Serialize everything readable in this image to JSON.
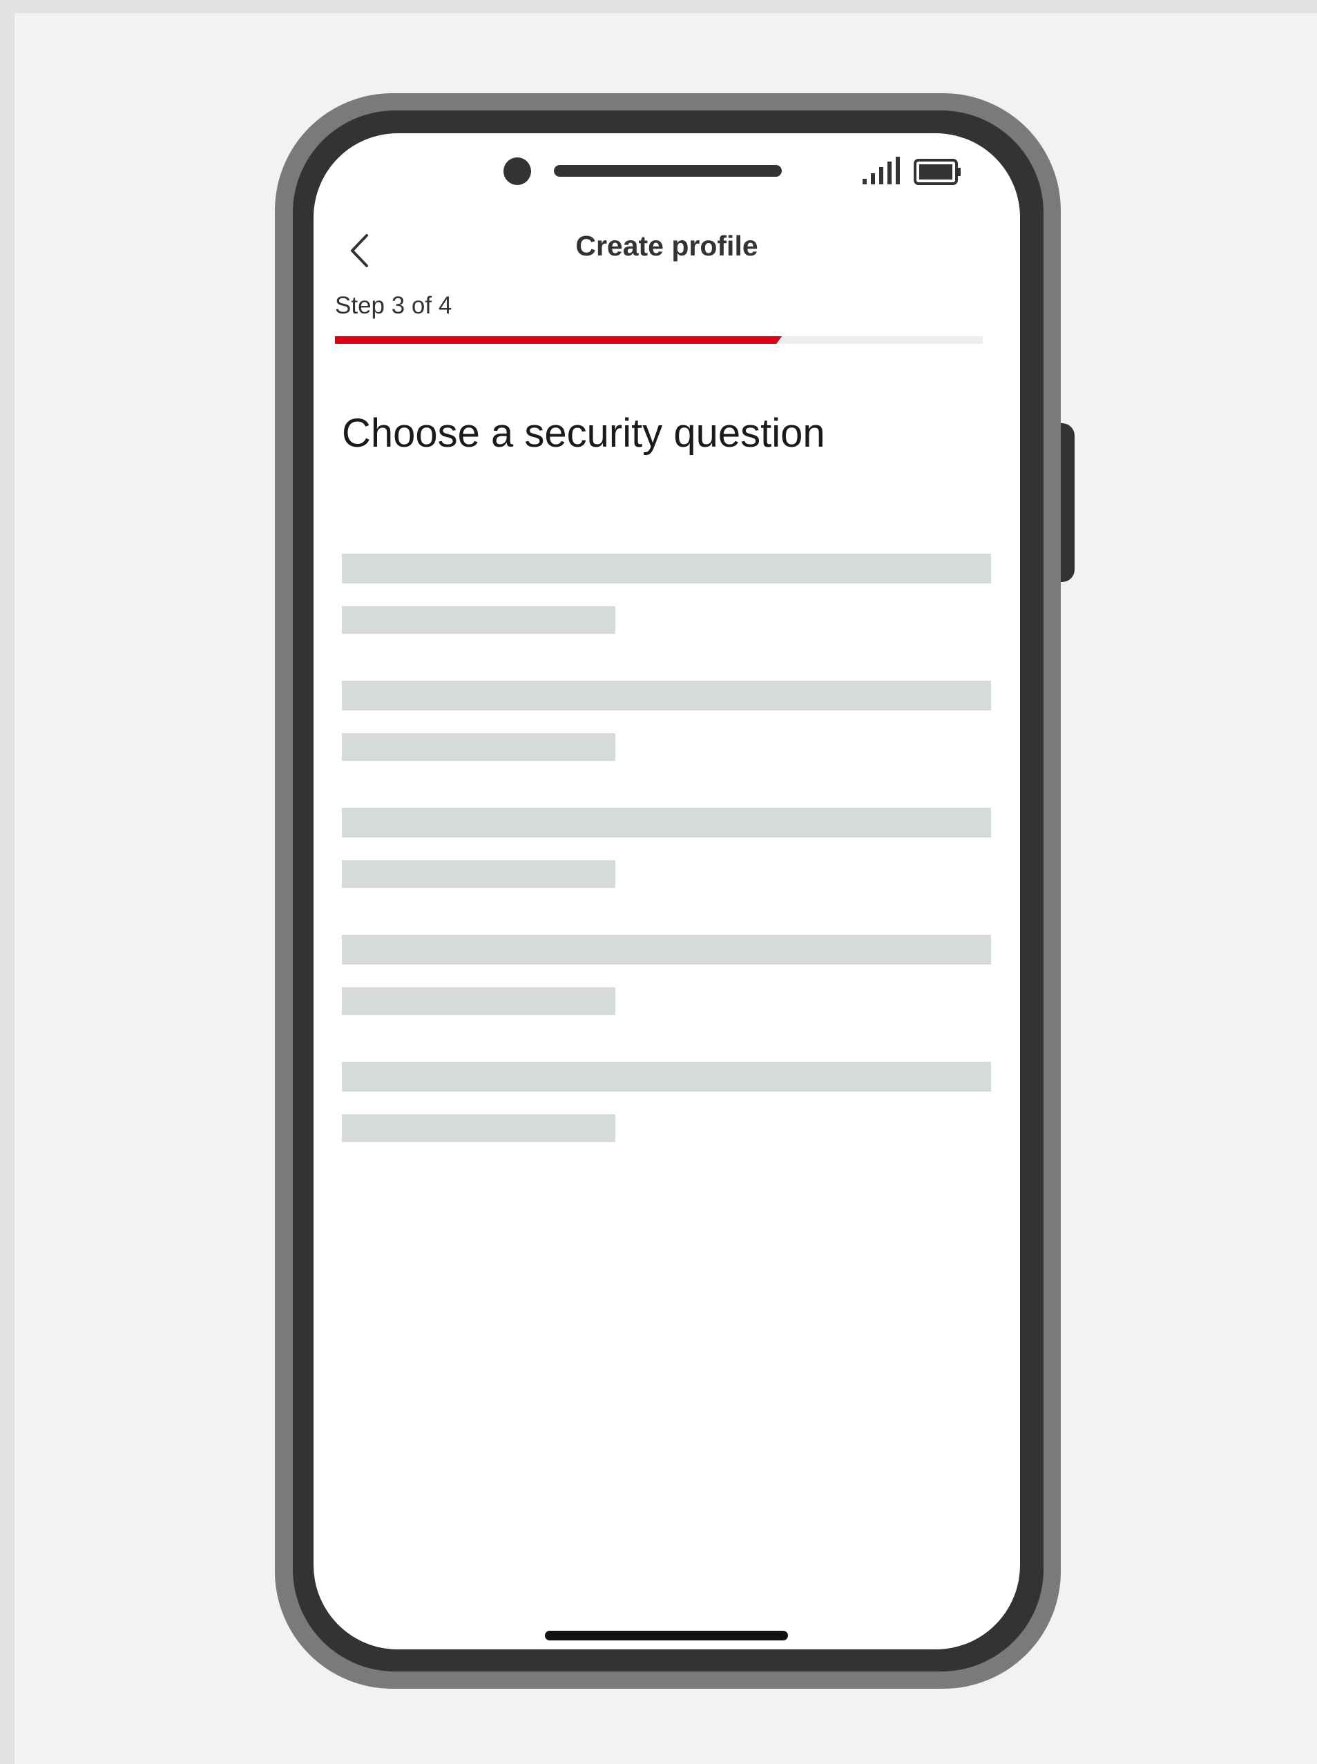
{
  "header": {
    "back_icon": "chevron-left-icon",
    "title": "Create profile"
  },
  "progress": {
    "step_label": "Step 3 of 4",
    "current_step": 3,
    "total_steps": 4,
    "fill_fraction": 0.69,
    "fill_color": "#db0011",
    "track_color": "#ededed"
  },
  "main": {
    "heading": "Choose a security question",
    "options_loading": true,
    "skeleton_option_count": 5
  },
  "status_bar": {
    "signal_icon": "signal-bars-icon",
    "battery_icon": "battery-icon"
  },
  "colors": {
    "accent": "#db0011",
    "skeleton": "#d7dadb",
    "phone_body": "#333333",
    "phone_rim": "#7a7a7a",
    "background": "#f2f2f2"
  }
}
